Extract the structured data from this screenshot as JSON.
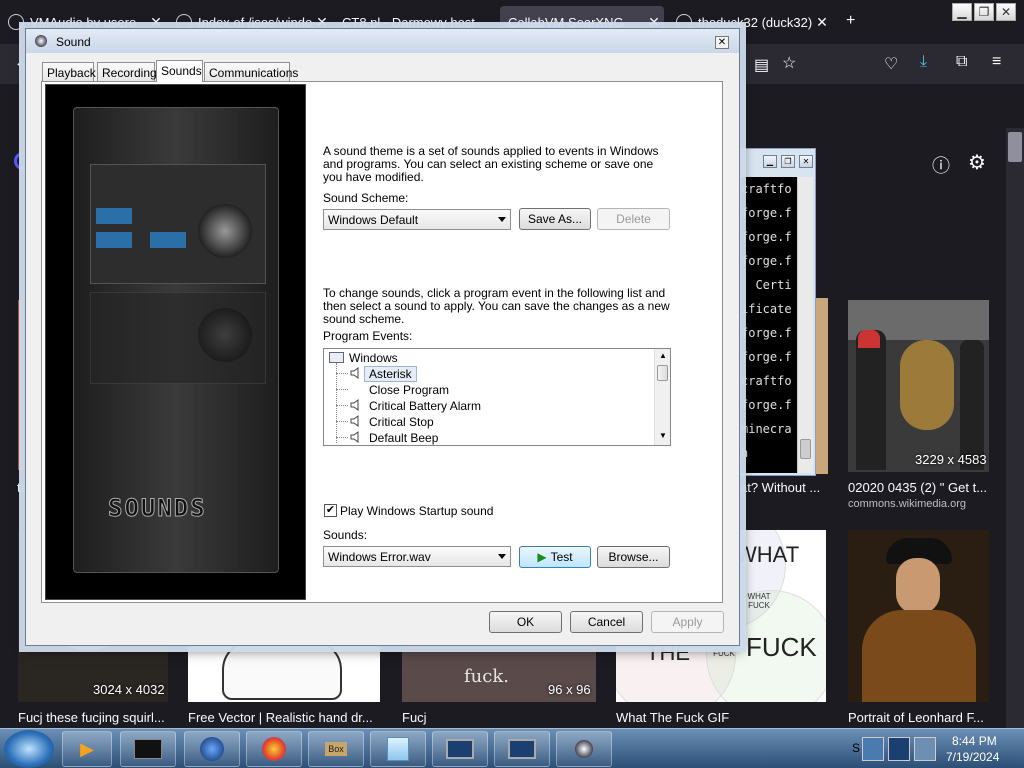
{
  "browser": {
    "tabs": [
      {
        "label": "VMAudio by usero"
      },
      {
        "label": "Index of /isos/windo"
      },
      {
        "label": "CT8.pl - Darmowy host"
      },
      {
        "label": "CollabVM SearXNG"
      },
      {
        "label": "theduck32 (duck32)"
      }
    ],
    "left_text": "Fo"
  },
  "images": [
    {
      "caption": "Fucj these fucjing squirl...",
      "dims": "3024 x 4032"
    },
    {
      "caption": "Free Vector | Realistic hand dr..."
    },
    {
      "caption": "Fucj",
      "dims": "96 x 96",
      "overlay": "fuck."
    },
    {
      "caption": "What The Fuck GIF",
      "venn": [
        "WHAT",
        "WHAT FUCK",
        "THE",
        "THE FUCK",
        "FUCK"
      ]
    },
    {
      "caption": "Portrait of Leonhard F..."
    },
    {
      "caption": "02020 0435 (2) \" Get t...",
      "dims": "3229 x 4583",
      "source": "commons.wikimedia.org"
    },
    {
      "caption": "at? Without ..."
    },
    {
      "caption": "ta"
    }
  ],
  "terminal": {
    "lines": [
      "craftfo",
      "forge.f",
      "forge.f",
      "forge.f",
      ". Certi",
      "ificate",
      "forge.f",
      "forge.f",
      "craftfo",
      "forge.f",
      "minecra",
      "h"
    ]
  },
  "dialog": {
    "title": "Sound",
    "close": "✕",
    "tabs": [
      "Playback",
      "Recording",
      "Sounds",
      "Communications"
    ],
    "art_text": "SOUNDS",
    "theme_description": "A sound theme is a set of sounds applied to events in Windows and programs.  You can select an existing scheme or save one you have modified.",
    "scheme_label": "Sound Scheme:",
    "scheme_value": "Windows Default",
    "save_as": "Save As...",
    "delete": "Delete",
    "change_description": "To change sounds, click a program event in the following list and then select a sound to apply.  You can save the changes as a new sound scheme.",
    "events_label": "Program Events:",
    "events": [
      {
        "label": "Windows",
        "group": true
      },
      {
        "label": "Asterisk",
        "selected": true,
        "sound": true
      },
      {
        "label": "Close Program",
        "sound": false
      },
      {
        "label": "Critical Battery Alarm",
        "sound": true
      },
      {
        "label": "Critical Stop",
        "sound": true
      },
      {
        "label": "Default Beep",
        "sound": true
      }
    ],
    "startup_checkbox": "Play Windows Startup sound",
    "startup_checked": true,
    "sounds_label": "Sounds:",
    "sound_value": "Windows Error.wav",
    "test": "Test",
    "browse": "Browse...",
    "ok": "OK",
    "cancel": "Cancel",
    "apply": "Apply"
  },
  "taskbar": {
    "time": "8:44 PM",
    "date": "7/19/2024",
    "box_label": "Box",
    "tray_text": "S"
  },
  "colors": {
    "browser_bg": "#1c1b22",
    "dialog_bg": "#f0f0f0",
    "taskbar": "#2c4f77",
    "selected_event": "#e5eef8"
  }
}
